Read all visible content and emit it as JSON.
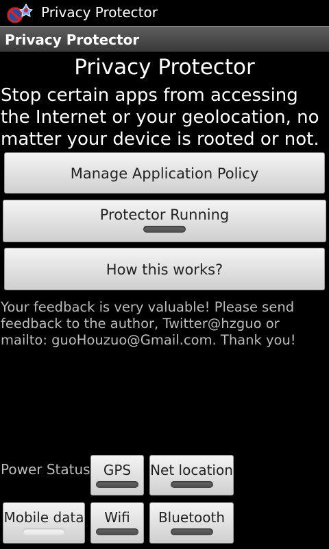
{
  "status_bar": {
    "app_icon": "privacy-protector-icon",
    "title": "Privacy Protector"
  },
  "action_bar": {
    "title": "Privacy Protector"
  },
  "main": {
    "heading": "Privacy Protector",
    "description": "Stop certain apps from accessing the Internet or your geolocation, no matter your device is rooted or not.",
    "buttons": {
      "manage": "Manage Application Policy",
      "running": "Protector Running",
      "running_on": true,
      "how": "How this works?"
    },
    "feedback": "Your feedback is very valuable! Please send feedback to the author, Twitter@hzguo or mailto: guoHouzuo@Gmail.com. Thank you!"
  },
  "power": {
    "label": "Power Status",
    "toggles": [
      {
        "label": "GPS",
        "on": true
      },
      {
        "label": "Net location",
        "on": true
      },
      {
        "label": "Mobile data",
        "on": false
      },
      {
        "label": "Wifi",
        "on": true
      },
      {
        "label": "Bluetooth",
        "on": true
      }
    ]
  },
  "colors": {
    "background": "#000000",
    "indicator_on": "#555555",
    "indicator_off": "#f0f0f0"
  }
}
